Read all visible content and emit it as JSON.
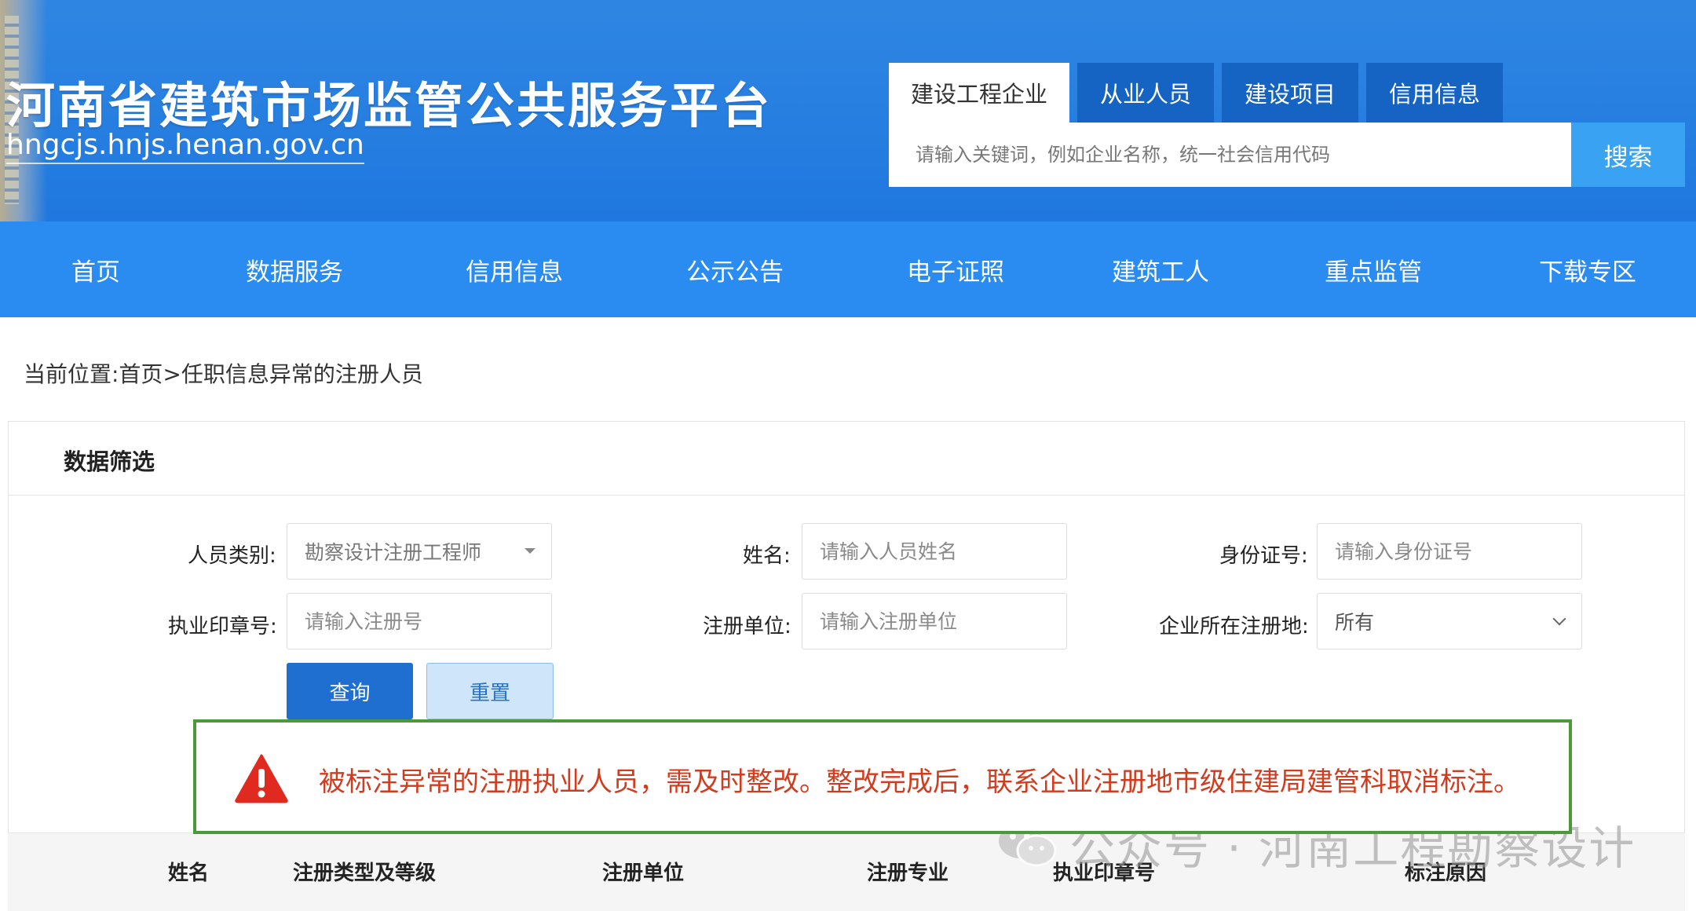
{
  "header": {
    "title": "河南省建筑市场监管公共服务平台",
    "url": "hngcjs.hnjs.henan.gov.cn",
    "search_tabs": [
      {
        "label": "建设工程企业",
        "active": true
      },
      {
        "label": "从业人员",
        "active": false
      },
      {
        "label": "建设项目",
        "active": false
      },
      {
        "label": "信用信息",
        "active": false
      }
    ],
    "search_placeholder": "请输入关键词，例如企业名称，统一社会信用代码",
    "search_button": "搜索"
  },
  "nav": {
    "items": [
      "首页",
      "数据服务",
      "信用信息",
      "公示公告",
      "电子证照",
      "建筑工人",
      "重点监管",
      "下载专区"
    ]
  },
  "breadcrumb": "当前位置:首页>任职信息异常的注册人员",
  "filter": {
    "title": "数据筛选",
    "fields": {
      "category": {
        "label": "人员类别:",
        "value": "勘察设计注册工程师"
      },
      "name": {
        "label": "姓名:",
        "placeholder": "请输入人员姓名"
      },
      "id_number": {
        "label": "身份证号:",
        "placeholder": "请输入身份证号"
      },
      "seal_number": {
        "label": "执业印章号:",
        "placeholder": "请输入注册号"
      },
      "reg_unit": {
        "label": "注册单位:",
        "placeholder": "请输入注册单位"
      },
      "reg_location": {
        "label": "企业所在注册地:",
        "value": "所有"
      }
    },
    "query_button": "查询",
    "reset_button": "重置"
  },
  "notice": {
    "text": "被标注异常的注册执业人员，需及时整改。整改完成后，联系企业注册地市级住建局建管科取消标注。"
  },
  "table": {
    "headers": [
      "姓名",
      "注册类型及等级",
      "注册单位",
      "注册专业",
      "执业印章号",
      "标注原因"
    ]
  },
  "watermark": {
    "text": "公众号 · 河南工程勘察设计"
  },
  "colors": {
    "header_blue": "#1f78df",
    "nav_blue": "#2a8cf0",
    "search_button": "#3aa2f2",
    "query_button": "#1f6fd0",
    "notice_text": "#d23c1e",
    "notice_border": "#4a9a3a",
    "warning_red": "#e02a1f"
  }
}
